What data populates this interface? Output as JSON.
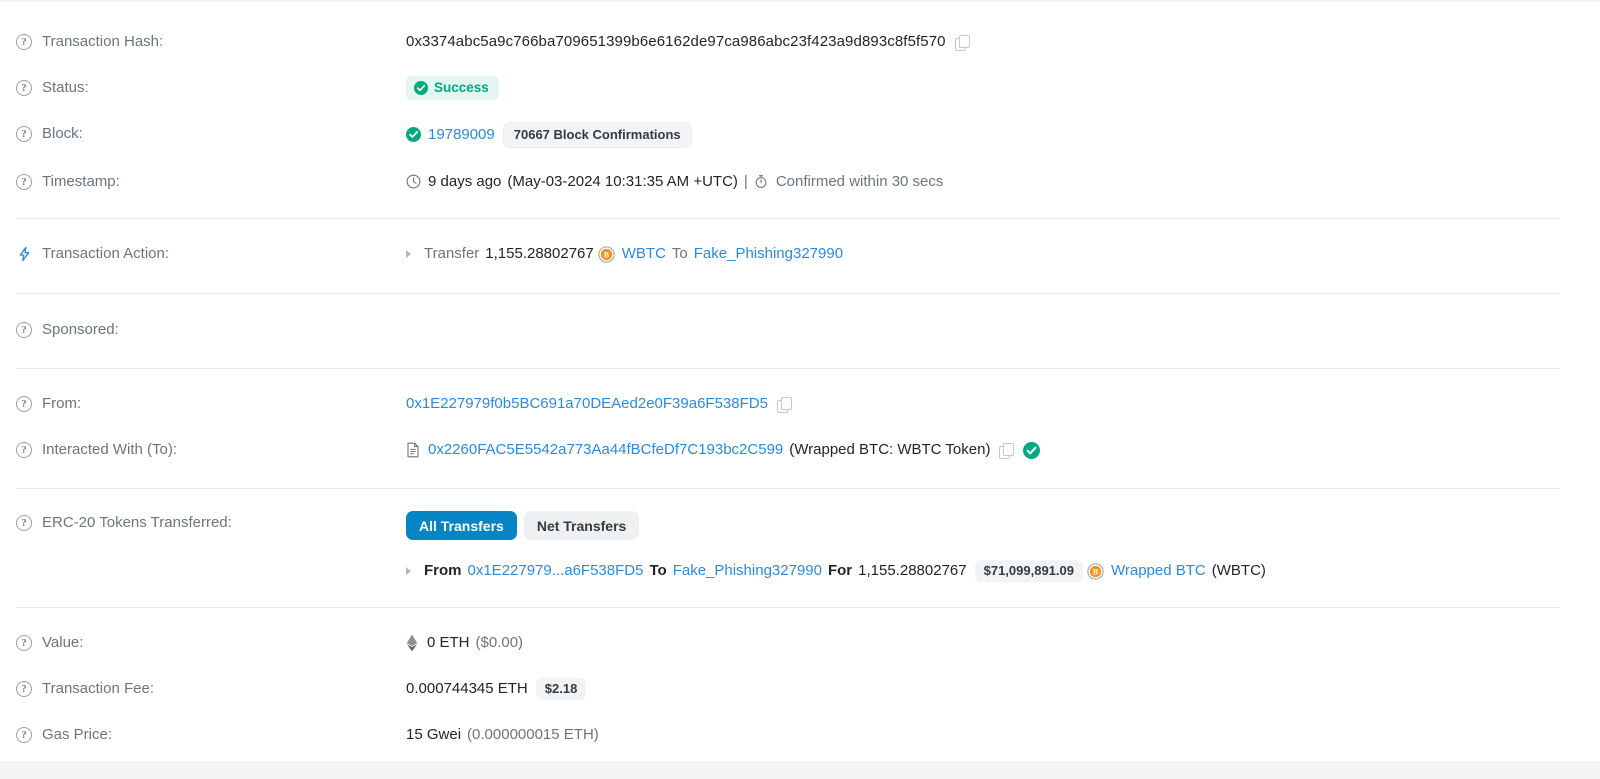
{
  "rows": {
    "tx_hash": {
      "label": "Transaction Hash:",
      "value": "0x3374abc5a9c766ba709651399b6e6162de97ca986abc23f423a9d893c8f5f570"
    },
    "status": {
      "label": "Status:",
      "value": "Success"
    },
    "block": {
      "label": "Block:",
      "number": "19789009",
      "confirmations": "70667 Block Confirmations"
    },
    "timestamp": {
      "label": "Timestamp:",
      "relative": "9 days ago",
      "absolute": "(May-03-2024 10:31:35 AM +UTC)",
      "divider": "|",
      "confirmed": "Confirmed within 30 secs"
    },
    "transaction_action": {
      "label": "Transaction Action:",
      "verb": "Transfer",
      "amount": "1,155.28802767",
      "token": "WBTC",
      "to_word": "To",
      "recipient": "Fake_Phishing327990"
    },
    "sponsored": {
      "label": "Sponsored:",
      "value": ""
    },
    "from": {
      "label": "From:",
      "address": "0x1E227979f0b5BC691a70DEAed2e0F39a6F538FD5"
    },
    "interacted_with": {
      "label": "Interacted With (To):",
      "address": "0x2260FAC5E5542a773Aa44fBCfeDf7C193bc2C599",
      "name_tag": "(Wrapped BTC: WBTC Token)"
    },
    "erc20": {
      "label": "ERC-20 Tokens Transferred:",
      "tab_all": "All Transfers",
      "tab_net": "Net Transfers",
      "transfer": {
        "from_word": "From",
        "from_address": "0x1E227979...a6F538FD5",
        "to_word": "To",
        "to_name": "Fake_Phishing327990",
        "for_word": "For",
        "amount": "1,155.28802767",
        "usd_value": "$71,099,891.09",
        "token_name": "Wrapped BTC",
        "token_symbol": "(WBTC)"
      }
    },
    "value": {
      "label": "Value:",
      "amount": "0 ETH",
      "usd": "($0.00)"
    },
    "transaction_fee": {
      "label": "Transaction Fee:",
      "amount": "0.000744345 ETH",
      "usd": "$2.18"
    },
    "gas_price": {
      "label": "Gas Price:",
      "amount": "15 Gwei",
      "eth": "(0.000000015 ETH)"
    }
  },
  "colors": {
    "link": "#2a8ae0",
    "success": "#00a97f",
    "success_bg": "#e4f6f0",
    "pill_active": "#0784c3",
    "muted": "#6c757d",
    "token_orange": "#f7931a"
  }
}
